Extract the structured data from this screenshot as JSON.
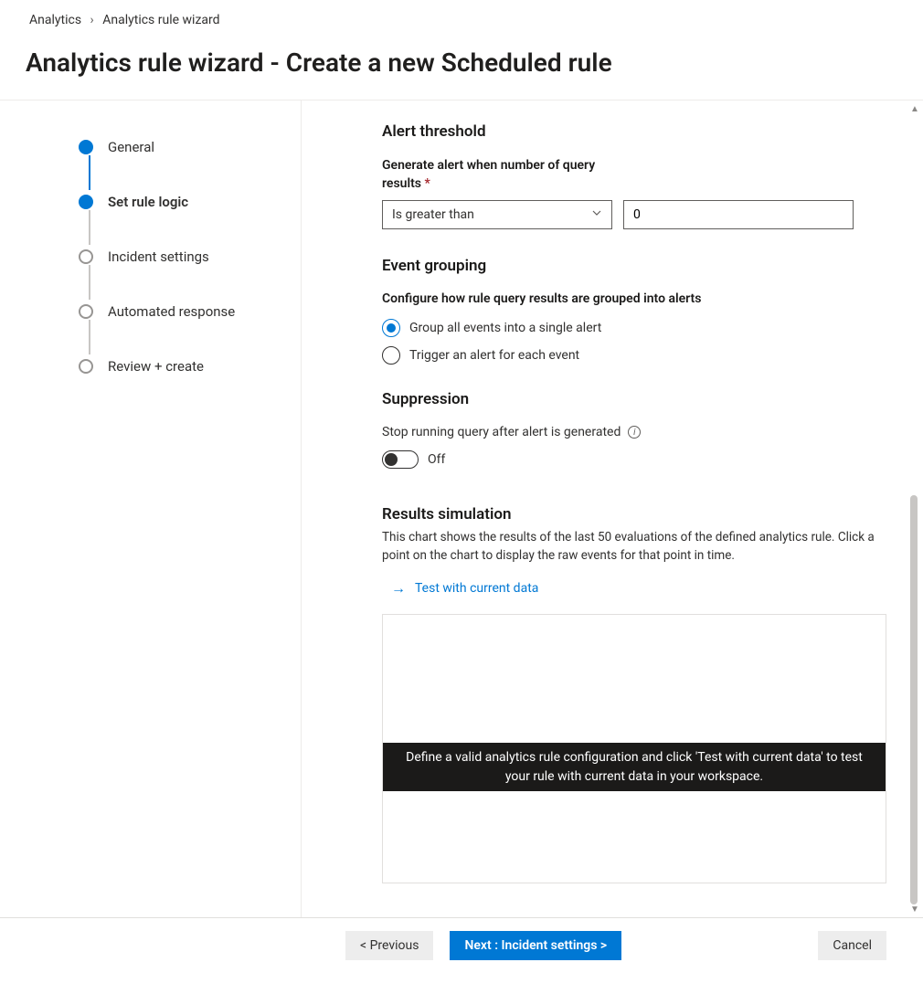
{
  "breadcrumb": {
    "root": "Analytics",
    "current": "Analytics rule wizard"
  },
  "page_title": "Analytics rule wizard - Create a new Scheduled rule",
  "steps": [
    {
      "label": "General"
    },
    {
      "label": "Set rule logic"
    },
    {
      "label": "Incident settings"
    },
    {
      "label": "Automated response"
    },
    {
      "label": "Review + create"
    }
  ],
  "alert_threshold": {
    "heading": "Alert threshold",
    "label_line1": "Generate alert when number of query",
    "label_line2": "results",
    "operator": "Is greater than",
    "value": "0"
  },
  "event_grouping": {
    "heading": "Event grouping",
    "sub_label": "Configure how rule query results are grouped into alerts",
    "option_a": "Group all events into a single alert",
    "option_b": "Trigger an alert for each event"
  },
  "suppression": {
    "heading": "Suppression",
    "label": "Stop running query after alert is generated",
    "state_text": "Off"
  },
  "results_sim": {
    "heading": "Results simulation",
    "desc": "This chart shows the results of the last 50 evaluations of the defined analytics rule. Click a point on the chart to display the raw events for that point in time.",
    "test_link": "Test with current data",
    "chart_msg": "Define a valid analytics rule configuration and click 'Test with current data' to test your rule with current data in your workspace."
  },
  "footer": {
    "previous": "< Previous",
    "next": "Next : Incident settings >",
    "cancel": "Cancel"
  }
}
